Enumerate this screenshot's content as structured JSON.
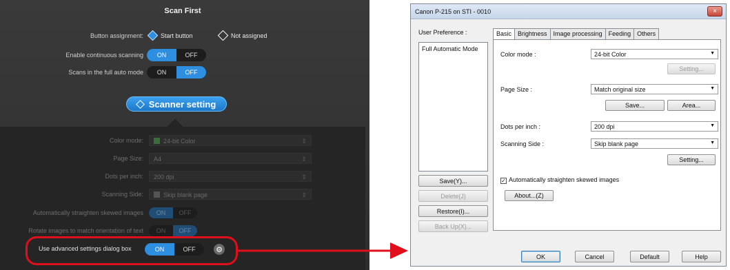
{
  "left_panel": {
    "title": "Scan First",
    "button_assignment": {
      "label": "Button assignment:",
      "option1": "Start button",
      "option2": "Not assigned"
    },
    "continuous": {
      "label": "Enable continuous scanning",
      "on": "ON",
      "off": "OFF",
      "selected": "ON"
    },
    "full_auto": {
      "label": "Scans in the full auto mode",
      "on": "ON",
      "off": "OFF",
      "selected": "OFF"
    },
    "scanner_setting_label": "Scanner setting",
    "color_mode": {
      "label": "Color mode:",
      "value": "24-bit Color"
    },
    "page_size": {
      "label": "Page Size:",
      "value": "A4"
    },
    "dpi": {
      "label": "Dots per inch:",
      "value": "200 dpi"
    },
    "scanning_side": {
      "label": "Scanning Side:",
      "value": "Skip blank page"
    },
    "straighten": {
      "label": "Automatically straighten skewed images",
      "on": "ON",
      "off": "OFF"
    },
    "rotate": {
      "label": "Rotate images to match orientation of text",
      "on": "ON",
      "off": "OFF"
    },
    "advanced": {
      "label": "Use advanced settings dialog box",
      "on": "ON",
      "off": "OFF",
      "selected": "ON"
    }
  },
  "dialog": {
    "title": "Canon P-215 on STI - 0010",
    "close": "×",
    "user_pref_label": "User Preference :",
    "user_pref_items": [
      "Full Automatic Mode"
    ],
    "left_buttons": [
      "Save(Y)...",
      "Delete(J)",
      "Restore(I)...",
      "Back Up(X)..."
    ],
    "tabs": [
      "Basic",
      "Brightness",
      "Image processing",
      "Feeding",
      "Others"
    ],
    "active_tab": "Basic",
    "color_mode": {
      "label": "Color mode :",
      "value": "24-bit Color",
      "setting": "Setting..."
    },
    "page_size": {
      "label": "Page Size :",
      "value": "Match original size",
      "save": "Save...",
      "area": "Area..."
    },
    "dpi": {
      "label": "Dots per inch :",
      "value": "200 dpi"
    },
    "scanning_side": {
      "label": "Scanning Side :",
      "value": "Skip blank page",
      "setting": "Setting..."
    },
    "straighten": {
      "label": "Automatically straighten skewed images",
      "checked": true
    },
    "about": "About...(Z)",
    "bottom_buttons": [
      "OK",
      "Cancel",
      "Default",
      "Help"
    ]
  },
  "colors": {
    "accent_blue": "#2e8fe0",
    "highlight_red": "#e10e1b"
  }
}
